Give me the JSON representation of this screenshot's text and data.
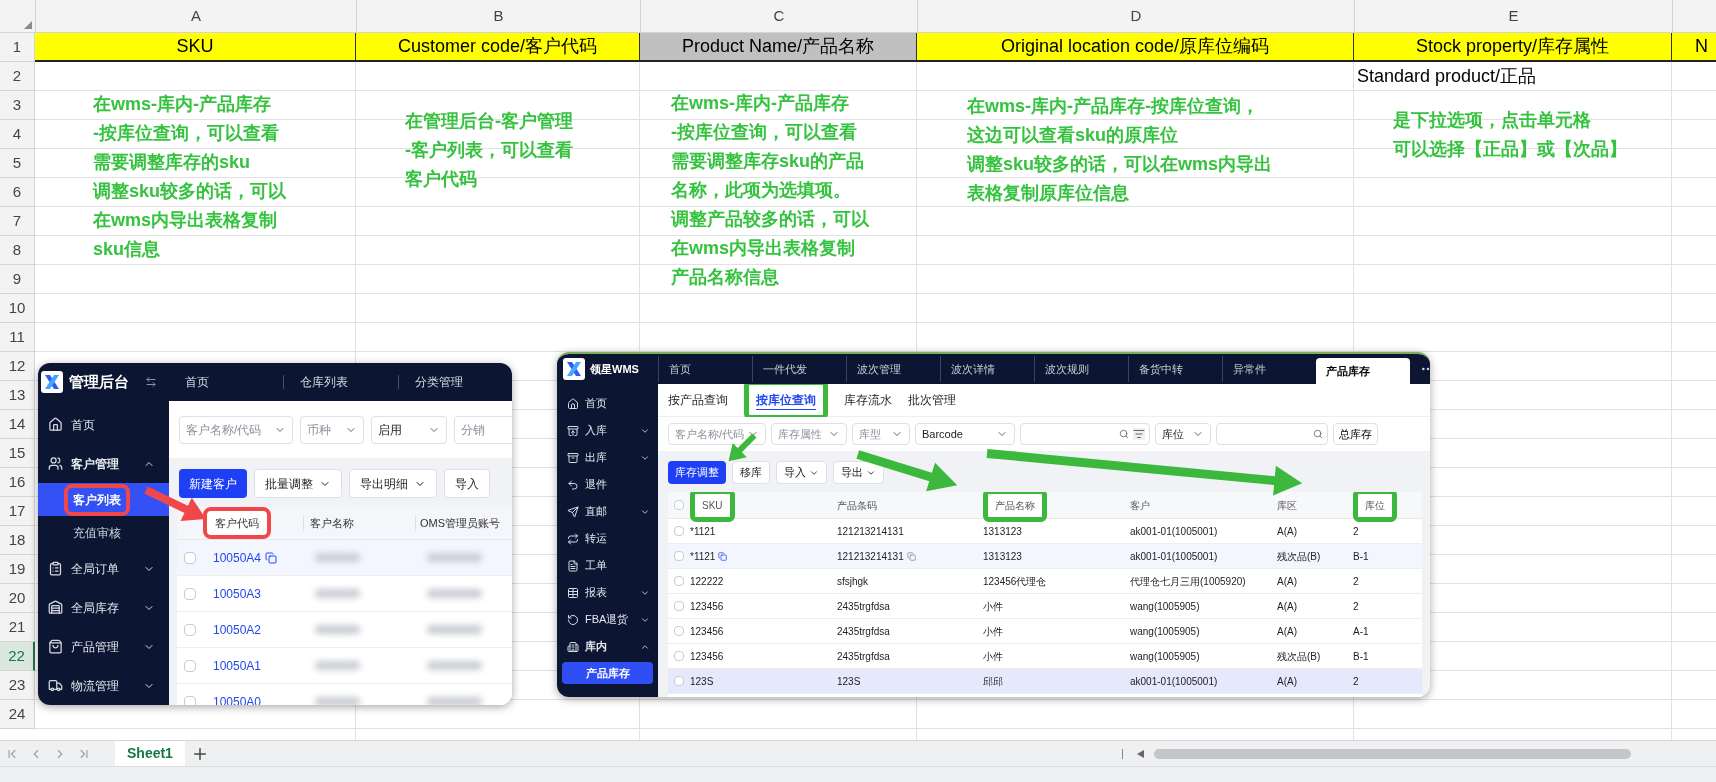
{
  "sheet": {
    "columns": [
      {
        "letter": "A",
        "title": "SKU",
        "color": "#ffff00"
      },
      {
        "letter": "B",
        "title": "Customer code/客户代码",
        "color": "#ffff00"
      },
      {
        "letter": "C",
        "title": "Product Name/产品名称",
        "color": "#c0c0c0"
      },
      {
        "letter": "D",
        "title": "Original location code/原库位编码",
        "color": "#ffff00"
      },
      {
        "letter": "E",
        "title": "Stock property/库存属性",
        "color": "#ffff00",
        "row_2": "Standard product/正品"
      },
      {
        "title": "N",
        "color": "#ffff00"
      }
    ],
    "rows": [
      {
        "label": "1",
        "selected": false
      },
      {
        "label": "2",
        "selected": false
      },
      {
        "label": "3",
        "selected": false
      },
      {
        "label": "4",
        "selected": false
      },
      {
        "label": "5",
        "selected": false
      },
      {
        "label": "6",
        "selected": false
      },
      {
        "label": "7",
        "selected": false
      },
      {
        "label": "8",
        "selected": false
      },
      {
        "label": "9",
        "selected": false
      },
      {
        "label": "10",
        "selected": false
      },
      {
        "label": "11",
        "selected": false
      },
      {
        "label": "12",
        "selected": false
      },
      {
        "label": "13",
        "selected": false
      },
      {
        "label": "14",
        "selected": false
      },
      {
        "label": "15",
        "selected": false
      },
      {
        "label": "16",
        "selected": false
      },
      {
        "label": "17",
        "selected": false
      },
      {
        "label": "18",
        "selected": false
      },
      {
        "label": "19",
        "selected": false
      },
      {
        "label": "20",
        "selected": false
      },
      {
        "label": "21",
        "selected": false
      },
      {
        "label": "22",
        "selected": true
      },
      {
        "label": "23",
        "selected": false
      },
      {
        "label": "24",
        "selected": false
      }
    ],
    "notes": [
      {
        "lines": [
          "在wms-库内-产品库存",
          "-按库位查询，可以查看",
          "需要调整库存的sku",
          "调整sku较多的话，可以",
          "在wms内导出表格复制",
          "sku信息"
        ]
      },
      {
        "lines": [
          "在管理后台-客户管理",
          "-客户列表，可以查看",
          "客户代码"
        ]
      },
      {
        "lines": [
          "在wms-库内-产品库存",
          "-按库位查询，可以查看",
          "需要调整库存sku的产品",
          "名称，此项为选填项。",
          "调整产品较多的话，可以",
          "在wms内导出表格复制",
          "产品名称信息"
        ]
      },
      {
        "lines": [
          "在wms-库内-产品库存-按库位查询，",
          "这边可以查看sku的原库位",
          "调整sku较多的话，可以在wms内导出",
          "表格复制原库位信息"
        ]
      },
      {
        "lines": [
          "是下拉选项，点击单元格",
          "可以选择【正品】或【次品】"
        ]
      }
    ]
  },
  "admin_window": {
    "logo": "管理后台",
    "tabs": [
      "首页",
      "仓库列表",
      "分类管理"
    ],
    "sidebar": [
      {
        "label": "首页",
        "kind": "link"
      },
      {
        "label": "客户管理",
        "kind": "group",
        "expanded": true,
        "children": [
          {
            "label": "客户列表",
            "selected": true,
            "highlight": true
          },
          {
            "label": "充值审核",
            "selected": false,
            "highlight": false
          }
        ]
      },
      {
        "label": "全局订单",
        "kind": "group",
        "expanded": false
      },
      {
        "label": "全局库存",
        "kind": "group",
        "expanded": false
      },
      {
        "label": "产品管理",
        "kind": "group",
        "expanded": false
      },
      {
        "label": "物流管理",
        "kind": "group",
        "expanded": false
      }
    ],
    "filters": [
      {
        "placeholder": "客户名称/代码"
      },
      {
        "placeholder": "币种"
      },
      {
        "value": "启用"
      },
      {
        "placeholder": "分销"
      }
    ],
    "buttons": [
      {
        "label": "新建客户",
        "kind": "primary"
      },
      {
        "label": "批量调整",
        "kind": "dropdown"
      },
      {
        "label": "导出明细",
        "kind": "dropdown"
      },
      {
        "label": "导入",
        "kind": "plain"
      }
    ],
    "columns": [
      {
        "label": "客户代码",
        "highlight": true
      },
      {
        "label": "客户名称",
        "highlight": false
      },
      {
        "label": "OMS管理员账号",
        "highlight": false
      }
    ],
    "rows": [
      {
        "code": "10050A4",
        "hovered": true,
        "checked": false
      },
      {
        "code": "10050A3",
        "hovered": false,
        "checked": false
      },
      {
        "code": "10050A2",
        "hovered": false,
        "checked": false
      },
      {
        "code": "10050A1",
        "hovered": false,
        "checked": false
      },
      {
        "code": "10050A0",
        "hovered": false,
        "checked": false
      }
    ]
  },
  "wms_window": {
    "logo": "领星WMS",
    "tabs": [
      {
        "label": "首页",
        "selected": false
      },
      {
        "label": "一件代发",
        "selected": false
      },
      {
        "label": "波次管理",
        "selected": false
      },
      {
        "label": "波次详情",
        "selected": false
      },
      {
        "label": "波次规则",
        "selected": false
      },
      {
        "label": "备货中转",
        "selected": false
      },
      {
        "label": "异常件",
        "selected": false
      },
      {
        "label": "产品库存",
        "selected": true
      }
    ],
    "sidebar": [
      {
        "label": "首页",
        "kind": "link"
      },
      {
        "label": "入库",
        "kind": "group",
        "expanded": false
      },
      {
        "label": "出库",
        "kind": "group",
        "expanded": false
      },
      {
        "label": "退件",
        "kind": "link"
      },
      {
        "label": "直邮",
        "kind": "group",
        "expanded": false
      },
      {
        "label": "转运",
        "kind": "link"
      },
      {
        "label": "工单",
        "kind": "link"
      },
      {
        "label": "报表",
        "kind": "group",
        "expanded": false
      },
      {
        "label": "FBA退货",
        "kind": "group",
        "expanded": false
      },
      {
        "label": "库内",
        "kind": "group",
        "expanded": true,
        "children": [
          {
            "label": "产品库存",
            "selected": true
          }
        ]
      }
    ],
    "subtabs": [
      {
        "label": "按产品查询",
        "selected": false,
        "highlight": false
      },
      {
        "label": "按库位查询",
        "selected": true,
        "highlight": true
      },
      {
        "label": "库存流水",
        "selected": false,
        "highlight": false
      },
      {
        "label": "批次管理",
        "selected": false,
        "highlight": false
      }
    ],
    "filters": [
      {
        "placeholder": "客户名称/代码"
      },
      {
        "placeholder": "库存属性"
      },
      {
        "placeholder": "库型"
      },
      {
        "value": "Barcode"
      }
    ],
    "location_filter": {
      "value": "库位"
    },
    "total_button": "总库存",
    "buttons": [
      {
        "label": "库存调整",
        "kind": "primary"
      },
      {
        "label": "移库",
        "kind": "plain"
      },
      {
        "label": "导入",
        "kind": "dropdown"
      },
      {
        "label": "导出",
        "kind": "dropdown"
      }
    ],
    "select_all": {
      "checked": false
    },
    "columns": [
      {
        "label": "SKU",
        "highlight": true
      },
      {
        "label": "产品条码",
        "highlight": false
      },
      {
        "label": "产品名称",
        "highlight": true
      },
      {
        "label": "客户",
        "highlight": false
      },
      {
        "label": "库区",
        "highlight": false
      },
      {
        "label": "库位",
        "highlight": true
      }
    ],
    "rows": [
      {
        "cells": [
          "*1121",
          "121213214131",
          "1313123",
          "ak001-01(1005001)",
          "A(A)",
          "2"
        ],
        "hovered": false,
        "selected": false,
        "checked": false
      },
      {
        "cells": [
          "*1121",
          "121213214131",
          "1313123",
          "ak001-01(1005001)",
          "残次品(B)",
          "B-1"
        ],
        "hovered": true,
        "selected": false,
        "checked": false
      },
      {
        "cells": [
          "122222",
          "sfsjhgk",
          "123456代理仓",
          "代理仓七月三用(1005920)",
          "A(A)",
          "2"
        ],
        "hovered": false,
        "selected": false,
        "checked": false
      },
      {
        "cells": [
          "123456",
          "2435trgfdsa",
          "小件",
          "wang(1005905)",
          "A(A)",
          "2"
        ],
        "hovered": false,
        "selected": false,
        "checked": false
      },
      {
        "cells": [
          "123456",
          "2435trgfdsa",
          "小件",
          "wang(1005905)",
          "A(A)",
          "A-1"
        ],
        "hovered": false,
        "selected": false,
        "checked": false
      },
      {
        "cells": [
          "123456",
          "2435trgfdsa",
          "小件",
          "wang(1005905)",
          "残次品(B)",
          "B-1"
        ],
        "hovered": false,
        "selected": false,
        "checked": false
      },
      {
        "cells": [
          "123S",
          "123S",
          "邱邱",
          "ak001-01(1005001)",
          "A(A)",
          "2"
        ],
        "hovered": false,
        "selected": true,
        "checked": false
      }
    ]
  },
  "sheet_tabs": [
    {
      "label": "Sheet1",
      "selected": true
    }
  ]
}
